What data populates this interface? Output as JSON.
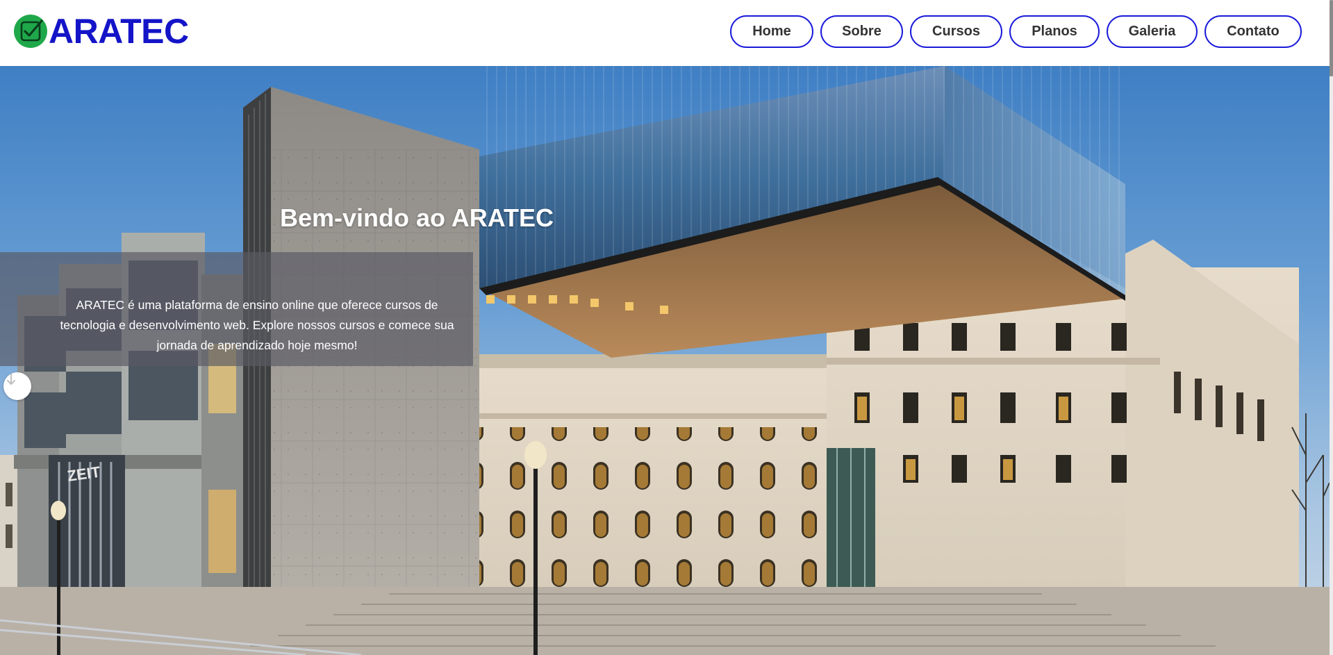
{
  "brand": {
    "name": "ARATEC",
    "logo_icon": "check-square-icon",
    "logo_color": "#1414c8",
    "icon_color": "#1fa84a"
  },
  "nav": {
    "items": [
      {
        "label": "Home"
      },
      {
        "label": "Sobre"
      },
      {
        "label": "Cursos"
      },
      {
        "label": "Planos"
      },
      {
        "label": "Galeria"
      },
      {
        "label": "Contato"
      }
    ],
    "border_color": "#1a1adb"
  },
  "hero": {
    "title": "Bem-vindo ao ARATEC",
    "description": "ARATEC é uma plataforma de ensino online que oferece cursos de tecnologia e desenvolvimento web. Explore nossos cursos e comece sua jornada de aprendizado hoje mesmo!",
    "arrow_icon": "chevron-down-icon"
  }
}
